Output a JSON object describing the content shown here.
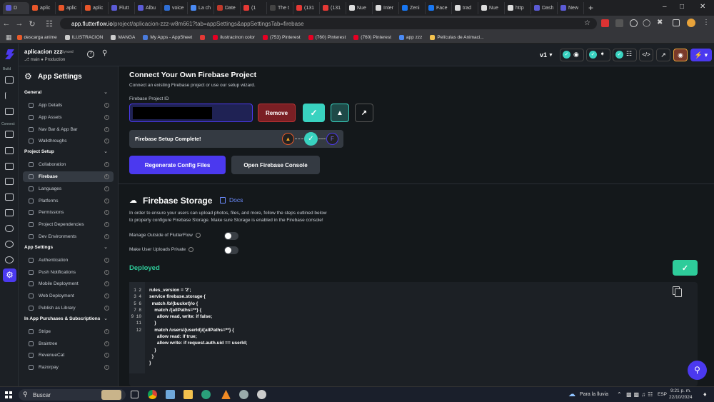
{
  "browser": {
    "tabs": [
      {
        "label": "D",
        "color": "#5b5bd6"
      },
      {
        "label": "aplic",
        "color": "#e8562a"
      },
      {
        "label": "aplic",
        "color": "#e8562a"
      },
      {
        "label": "aplic",
        "color": "#e8562a"
      },
      {
        "label": "Flutt",
        "color": "#5b5bd6"
      },
      {
        "label": "Albu",
        "color": "#5b5bd6"
      },
      {
        "label": "voice",
        "color": "#2f6fd6"
      },
      {
        "label": "La ch",
        "color": "#4a8af4"
      },
      {
        "label": "Date",
        "color": "#c0392b"
      },
      {
        "label": "(1",
        "color": "#e53935"
      },
      {
        "label": "The t",
        "color": "#444444"
      },
      {
        "label": "(131",
        "color": "#e53935"
      },
      {
        "label": "(131",
        "color": "#e53935"
      },
      {
        "label": "Nue",
        "color": "#dddddd"
      },
      {
        "label": "Inter",
        "color": "#dddddd"
      },
      {
        "label": "Zeni",
        "color": "#1877f2"
      },
      {
        "label": "Face",
        "color": "#1877f2"
      },
      {
        "label": "trad",
        "color": "#dddddd"
      },
      {
        "label": "Nue",
        "color": "#dddddd"
      },
      {
        "label": "http",
        "color": "#dddddd"
      },
      {
        "label": "Dash",
        "color": "#5b5bd6"
      },
      {
        "label": "New",
        "color": "#5b5bd6"
      }
    ],
    "active_tab_index": 0,
    "new_tab": "+",
    "url_host": "app.flutterflow.io",
    "url_path": "/project/aplicacion-zzz-w8m661?tab=appSettings&appSettingsTab=firebase",
    "bookmarks": [
      {
        "label": "descarga anime",
        "color": "#e85a2a"
      },
      {
        "label": "ILUSTRACION",
        "color": "#cccccc"
      },
      {
        "label": "MANGA",
        "color": "#cccccc"
      },
      {
        "label": "My Apps - AppSheet",
        "color": "#4a7bdc"
      },
      {
        "label": "",
        "color": "#e53935"
      },
      {
        "label": "ilustracinon color",
        "color": "#e60023"
      },
      {
        "label": "(753) Pinterest",
        "color": "#e60023"
      },
      {
        "label": "(760) Pinterest",
        "color": "#e60023"
      },
      {
        "label": "(760) Pinterest",
        "color": "#e60023"
      },
      {
        "label": "app zzz",
        "color": "#4a8af4"
      },
      {
        "label": "Películas de Animaci...",
        "color": "#f2c14e"
      }
    ]
  },
  "app": {
    "project_name": "aplicacion zzz",
    "sync_status": "Synced",
    "branch": "main",
    "environment": "Production",
    "version": "v1",
    "rail": {
      "build_label": "Build",
      "connect_label": "Connect"
    }
  },
  "sidebar": {
    "title": "App Settings",
    "sections": [
      {
        "title": "General",
        "items": [
          "App Details",
          "App Assets",
          "Nav Bar & App Bar",
          "Walkthroughs"
        ]
      },
      {
        "title": "Project Setup",
        "items": [
          "Collaboration",
          "Firebase",
          "Languages",
          "Platforms",
          "Permissions",
          "Project Dependencies",
          "Dev Environments"
        ]
      },
      {
        "title": "App Settings",
        "items": [
          "Authentication",
          "Push Notifications",
          "Mobile Deployment",
          "Web Deployment",
          "Publish as Library"
        ]
      },
      {
        "title": "In App Purchases & Subscriptions",
        "items": [
          "Stripe",
          "Braintree",
          "RevenueCat",
          "Razorpay"
        ]
      }
    ],
    "selected": "Firebase"
  },
  "main": {
    "connect_title": "Connect Your Own Firebase Project",
    "connect_desc": "Connect an existing Firebase project or use our setup wizard.",
    "project_id_label": "Firebase Project ID",
    "project_id_value": "",
    "remove_label": "Remove",
    "setup_complete": "Firebase Setup Complete!",
    "regenerate_label": "Regenerate Config Files",
    "open_console_label": "Open Firebase Console",
    "storage_title": "Firebase Storage",
    "docs_label": "Docs",
    "storage_desc_1": "In order to ensure your users can upload photos, files, and more, follow the steps outlined below",
    "storage_desc_2": "to properly configure Firebase Storage. Make sure Storage is enabled in the Firebase console!",
    "manage_outside_label": "Manage Outside of FlutterFlow",
    "manage_outside_on": false,
    "private_uploads_label": "Make User Uploads Private",
    "private_uploads_on": false,
    "deployed_label": "Deployed",
    "code_line_numbers": "1\n2\n3\n4\n5\n6\n7\n8\n9\n10\n11\n12",
    "code_text": "rules_version = '2';\nservice firebase.storage {\n  match /b/{bucket}/o {\n    match /{allPaths=**} {\n      allow read, write: if false;\n    }\n    match /users/{userId}/{allPaths=**} {\n      allow read: if true;\n      allow write: if request.auth.uid == userId;\n    }\n  }\n}"
  },
  "colors": {
    "accent": "#4b39ef",
    "teal": "#39d2c0",
    "deployed_green": "#2ecc9a",
    "danger": "#7a1f24"
  },
  "taskbar": {
    "search_label": "Buscar",
    "weather": "Para la lluvia",
    "language": "ESP",
    "time": "9:21 p. m.",
    "date": "22/10/2024"
  }
}
